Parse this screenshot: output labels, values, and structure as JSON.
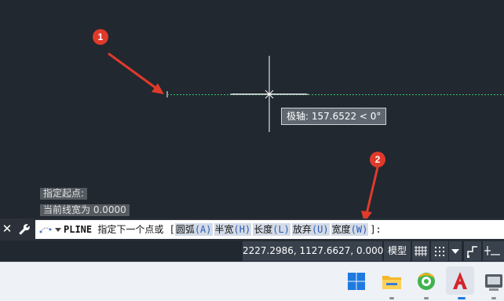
{
  "callouts": [
    "1",
    "2"
  ],
  "tooltip": {
    "text": "极轴: 157.6522 < 0°"
  },
  "history": [
    "指定起点:",
    "当前线宽为 0.0000"
  ],
  "command": {
    "close_icon": "✕",
    "name": "PLINE",
    "prompt": "指定下一个点或 [",
    "options": [
      {
        "label": "圆弧",
        "key": "(A)"
      },
      {
        "label": "半宽",
        "key": "(H)"
      },
      {
        "label": "长度",
        "key": "(L)"
      },
      {
        "label": "放弃",
        "key": "(U)"
      },
      {
        "label": "宽度",
        "key": "(W)"
      }
    ],
    "suffix": "]:"
  },
  "status": {
    "coordinates": "2227.2986, 1127.6627, 0.0000",
    "model_label": "模型"
  },
  "taskbar": {
    "items": [
      "windows-start-icon",
      "file-explorer-icon",
      "browser-icon",
      "autocad-icon",
      "app-icon"
    ]
  },
  "colors": {
    "canvas": "#212830",
    "polyline": "#39c46a",
    "callout": "#e03a2b",
    "autocad": "#d4252c"
  }
}
